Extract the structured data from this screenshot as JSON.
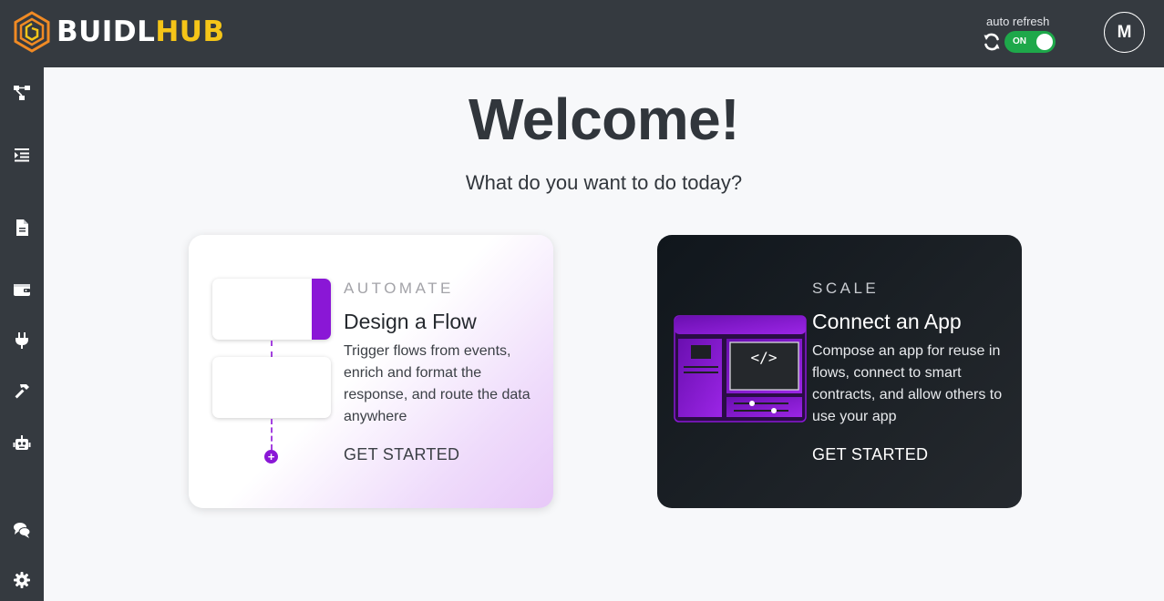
{
  "header": {
    "logo": {
      "part1": "BUIDL",
      "part2": "HUB",
      "mark_icon": "hexagon-logo-icon"
    },
    "auto_refresh": {
      "label": "auto refresh",
      "toggle_text": "ON",
      "icon": "refresh-icon"
    },
    "avatar": {
      "initial": "M"
    }
  },
  "sidebar": {
    "items": [
      {
        "name": "flows",
        "icon": "flow-icon"
      },
      {
        "name": "list",
        "icon": "indent-list-icon"
      },
      {
        "name": "documents",
        "icon": "document-icon"
      },
      {
        "name": "wallet",
        "icon": "wallet-icon"
      },
      {
        "name": "plugins",
        "icon": "plug-icon"
      },
      {
        "name": "tools",
        "icon": "hammer-icon"
      },
      {
        "name": "bots",
        "icon": "robot-icon"
      },
      {
        "name": "chat",
        "icon": "chat-icon"
      },
      {
        "name": "settings",
        "icon": "gear-icon"
      }
    ]
  },
  "main": {
    "title": "Welcome!",
    "subtitle": "What do you want to do today?",
    "cards": [
      {
        "eyebrow": "AUTOMATE",
        "title": "Design a Flow",
        "description": "Trigger flows from events, enrich and format the response, and route the data anywhere",
        "cta": "GET STARTED"
      },
      {
        "eyebrow": "SCALE",
        "title": "Connect an App",
        "description": "Compose an app for reuse in flows, connect to smart contracts, and allow others to use your app",
        "cta": "GET STARTED"
      }
    ]
  },
  "colors": {
    "header_bg": "#353a40",
    "brand_yellow": "#f5c518",
    "brand_orange": "#f08a24",
    "accent_purple": "#8a17d6",
    "toggle_green": "#1ea84a",
    "page_bg": "#f7f8fa"
  }
}
